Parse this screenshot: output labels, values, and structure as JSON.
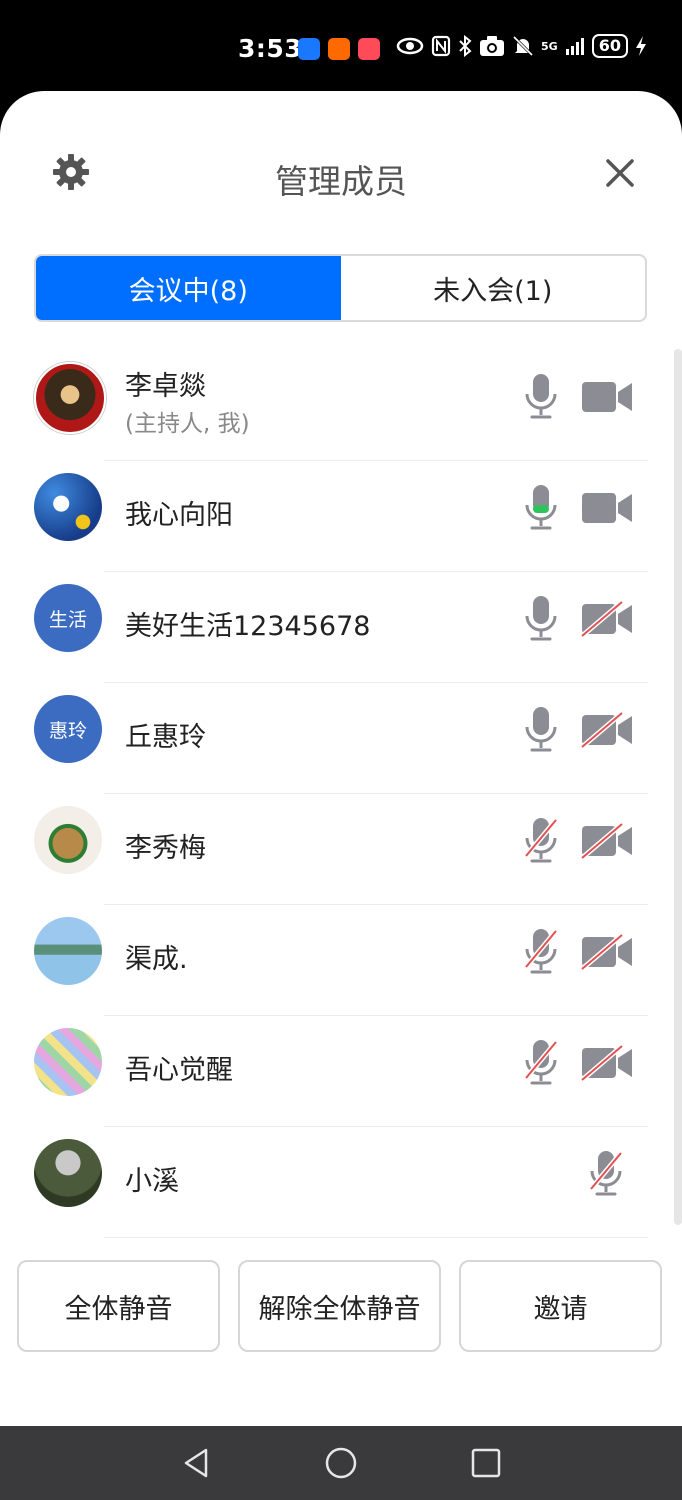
{
  "status_bar": {
    "time": "3:53",
    "network": "5G",
    "battery": "60",
    "app_icons": [
      "meituan-icon",
      "taobao-icon",
      "redbook-icon"
    ],
    "status_icons": [
      "eye-icon",
      "nfc-icon",
      "bluetooth-icon",
      "camera-icon",
      "bell-muted-icon",
      "signal-icon",
      "charging-icon"
    ]
  },
  "header": {
    "title": "管理成员"
  },
  "tabs": [
    {
      "label": "会议中(8)",
      "active": true
    },
    {
      "label": "未入会(1)",
      "active": false
    }
  ],
  "members": [
    {
      "name": "李卓燚",
      "subtitle": "(主持人, 我)",
      "avatar_text": "",
      "avatar_color": "#8a1f1f",
      "mic": "on",
      "camera": "on"
    },
    {
      "name": "我心向阳",
      "subtitle": "",
      "avatar_text": "",
      "avatar_color": "#2d5fb0",
      "mic": "speaking",
      "camera": "on"
    },
    {
      "name": "美好生活12345678",
      "subtitle": "",
      "avatar_text": "生活",
      "avatar_color": "#3b6cc1",
      "mic": "on",
      "camera": "off"
    },
    {
      "name": "丘惠玲",
      "subtitle": "",
      "avatar_text": "惠玲",
      "avatar_color": "#3b6cc1",
      "mic": "on",
      "camera": "off"
    },
    {
      "name": "李秀梅",
      "subtitle": "",
      "avatar_text": "",
      "avatar_color": "#c9a36b",
      "mic": "off",
      "camera": "off"
    },
    {
      "name": "渠成.",
      "subtitle": "",
      "avatar_text": "",
      "avatar_color": "#7fb3de",
      "mic": "off",
      "camera": "off"
    },
    {
      "name": "吾心觉醒",
      "subtitle": "",
      "avatar_text": "",
      "avatar_color": "#d7a9d6",
      "mic": "off",
      "camera": "off"
    },
    {
      "name": "小溪",
      "subtitle": "",
      "avatar_text": "",
      "avatar_color": "#5b6b4a",
      "mic": "off",
      "camera": "none"
    }
  ],
  "footer": {
    "mute_all": "全体静音",
    "unmute_all": "解除全体静音",
    "invite": "邀请"
  },
  "colors": {
    "accent": "#006eff",
    "icon_gray": "#8c8c94",
    "muted_red": "#e05252",
    "speaking_green": "#2ec45c"
  }
}
